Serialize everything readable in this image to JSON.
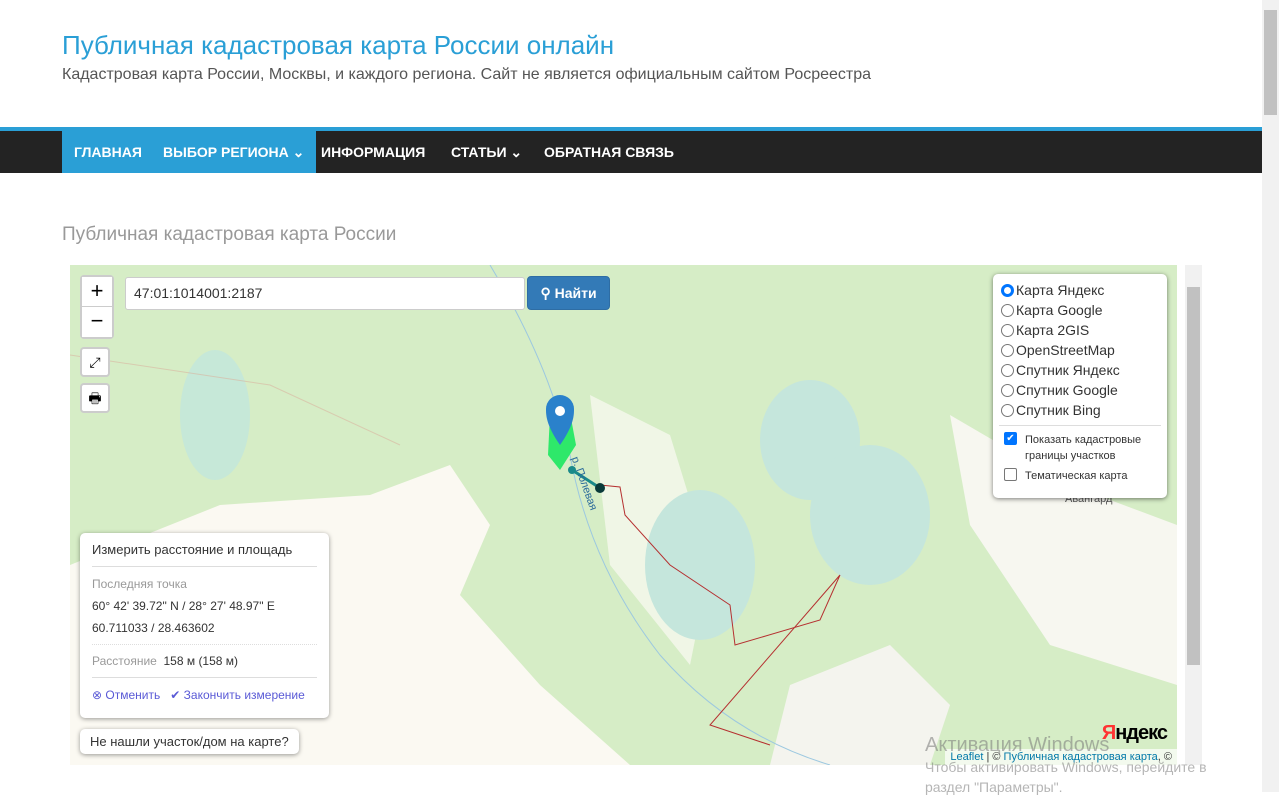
{
  "header": {
    "title": "Публичная кадастровая карта России онлайн",
    "subtitle": "Кадастровая карта России, Москвы, и каждого региона. Сайт не является официальным сайтом Росреестра"
  },
  "nav": [
    {
      "label": "ГЛАВНАЯ"
    },
    {
      "label": "ВЫБОР РЕГИОНА ⌄"
    },
    {
      "label": "ИНФОРМАЦИЯ"
    },
    {
      "label": "СТАТЬИ ⌄"
    },
    {
      "label": "ОБРАТНАЯ СВЯЗЬ"
    }
  ],
  "page_title": "Публичная кадастровая карта России",
  "map": {
    "zoom_in": "+",
    "zoom_out": "−",
    "search_value": "47:01:1014001:2187",
    "find_label": "Найти",
    "layers": [
      {
        "label": "Карта Яндекс",
        "selected": true
      },
      {
        "label": "Карта Google"
      },
      {
        "label": "Карта 2GIS"
      },
      {
        "label": "OpenStreetMap"
      },
      {
        "label": "Спутник Яндекс"
      },
      {
        "label": "Спутник Google"
      },
      {
        "label": "Спутник Bing"
      }
    ],
    "overlays": [
      {
        "label": "Показать кадастровые границы участков",
        "checked": true
      },
      {
        "label": "Тематическая карта",
        "checked": false
      }
    ],
    "measure": {
      "title": "Измерить расстояние и площадь",
      "last_point_label": "Последняя точка",
      "dms": "60° 42' 39.72\" N / 28° 27' 48.97\" E",
      "decimal": "60.711033 / 28.463602",
      "distance_label": "Расстояние",
      "distance_value": "158 м (158 м)",
      "cancel": "Отменить",
      "finish": "Закончить измерение"
    },
    "not_found": "Не нашли участок/дом на карте?",
    "labels": {
      "river": "р. Полевая",
      "village": "Авангард"
    },
    "yandex_logo": "Яндекс",
    "attribution": {
      "leaflet": "Leaflet",
      "sep": " | © ",
      "pkk": "Публичная кадастровая карта",
      "tail": ", ©"
    }
  },
  "windows": {
    "line1": "Активация Windows",
    "line2": "Чтобы активировать Windows, перейдите в",
    "line3": "раздел \"Параметры\"."
  }
}
